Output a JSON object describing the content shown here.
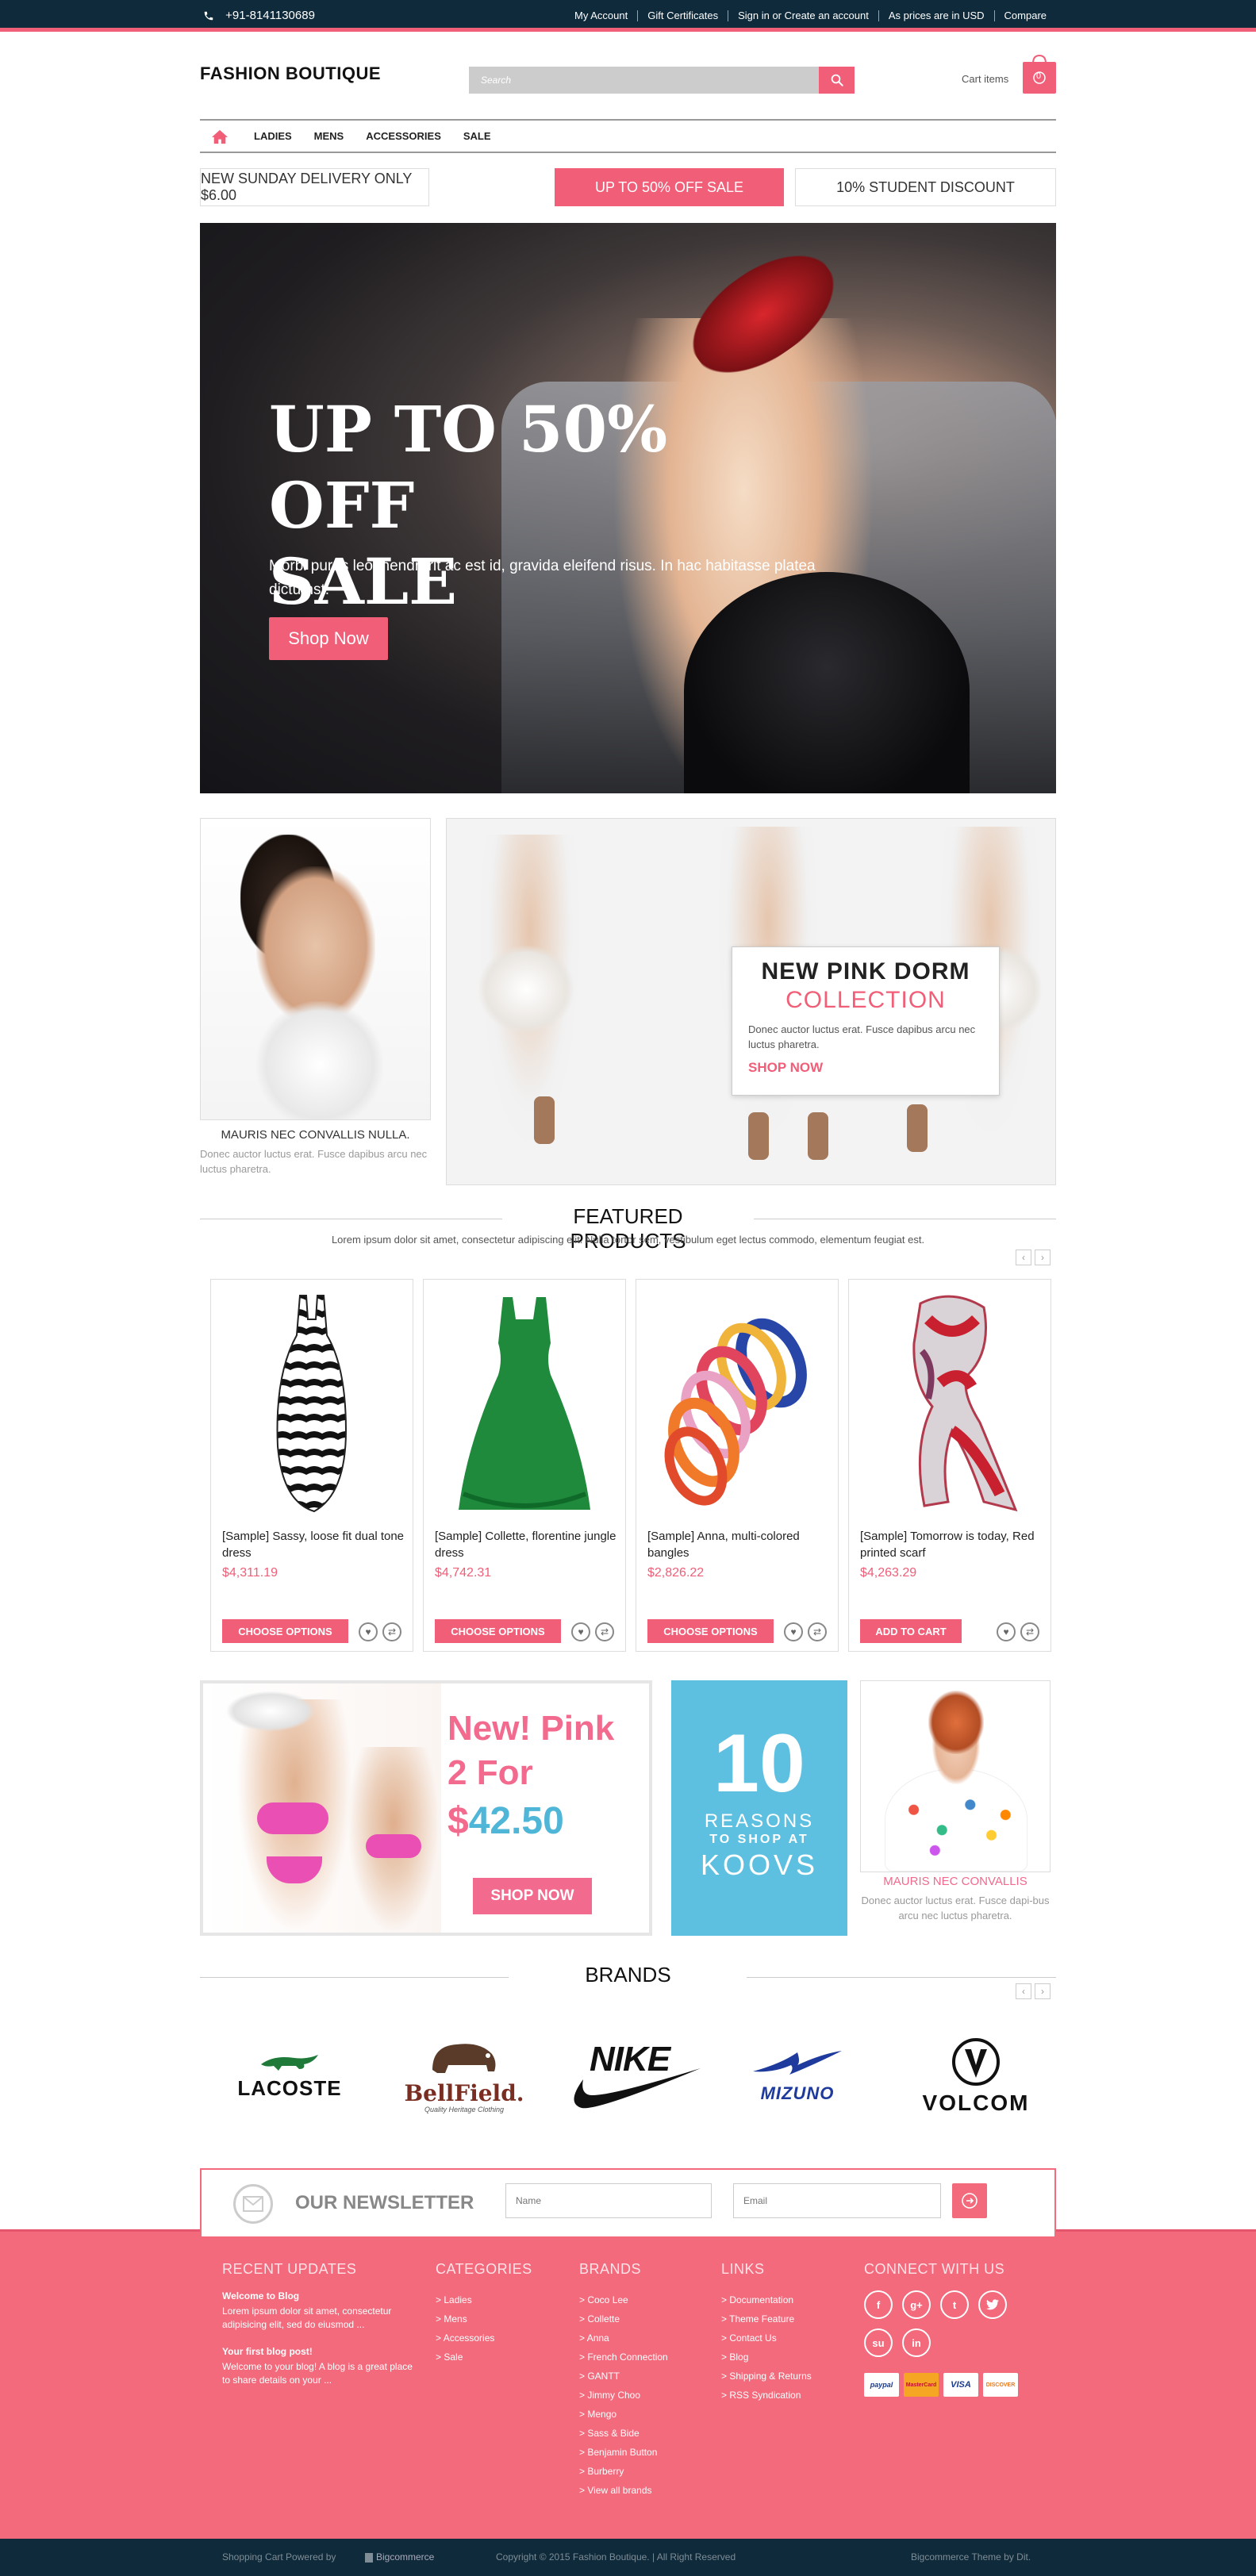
{
  "topbar": {
    "phone": "+91-8141130689",
    "links": [
      "My Account",
      "Gift Certificates",
      "Sign in or Create an account",
      "As prices are in USD",
      "Compare"
    ]
  },
  "header": {
    "logo": "FASHION BOUTIQUE",
    "search_placeholder": "Search",
    "cart_label": "Cart items",
    "cart_count": "0"
  },
  "nav": {
    "items": [
      "LADIES",
      "MENS",
      "ACCESSORIES",
      "SALE"
    ]
  },
  "promos": [
    "NEW SUNDAY DELIVERY ONLY $6.00",
    "UP TO 50% OFF SALE",
    "10% STUDENT DISCOUNT"
  ],
  "hero": {
    "title_line1": "UP TO 50% OFF",
    "title_line2": "SALE",
    "text": "Morbi purus leo, hendrerit ac est id, gravida eleifend risus. In hac habitasse platea dictumst.",
    "button": "Shop Now"
  },
  "banner_left": {
    "caption": "MAURIS NEC CONVALLIS NULLA.",
    "text": "Donec auctor luctus erat. Fusce dapibus arcu nec luctus pharetra."
  },
  "banner_right": {
    "title1": "NEW PINK DORM",
    "title2": "COLLECTION",
    "text": "Donec auctor luctus erat. Fusce dapibus arcu nec luctus pharetra.",
    "link": "SHOP NOW"
  },
  "featured": {
    "title": "FEATURED PRODUCTS",
    "subtitle": "Lorem ipsum dolor sit amet, consectetur adipiscing elit. Nulla tortor sem, vestibulum eget lectus commodo, elementum feugiat est.",
    "products": [
      {
        "name": "[Sample] Sassy, loose fit dual tone dress",
        "price": "$4,311.19",
        "button": "CHOOSE OPTIONS"
      },
      {
        "name": "[Sample] Collette, florentine jungle dress",
        "price": "$4,742.31",
        "button": "CHOOSE OPTIONS"
      },
      {
        "name": "[Sample] Anna, multi-colored bangles",
        "price": "$2,826.22",
        "button": "CHOOSE OPTIONS"
      },
      {
        "name": "[Sample] Tomorrow is today, Red printed scarf",
        "price": "$4,263.29",
        "button": "ADD TO CART"
      }
    ]
  },
  "promo_pink": {
    "line1": "New! Pink",
    "line2": "2 For",
    "currency": "$",
    "amount": "42.50",
    "button": "SHOP NOW"
  },
  "promo_blue": {
    "number": "10",
    "line1": "REASONS",
    "line2": "TO SHOP AT",
    "line3": "KOOVS"
  },
  "promo_girl": {
    "caption": "MAURIS NEC CONVALLIS",
    "text": "Donec auctor luctus erat. Fusce dapi-bus arcu nec luctus pharetra."
  },
  "brands": {
    "title": "BRANDS",
    "logos": [
      "LACOSTE",
      "BellField.",
      "Quality Heritage Clothing",
      "NIKE",
      "MIZUNO",
      "VOLCOM"
    ]
  },
  "newsletter": {
    "title": "OUR NEWSLETTER",
    "name_placeholder": "Name",
    "email_placeholder": "Email"
  },
  "footer": {
    "recent": {
      "heading": "RECENT UPDATES",
      "posts": [
        {
          "title": "Welcome to Blog",
          "text": "Lorem ipsum dolor sit amet, consectetur adipisicing elit, sed do eiusmod ..."
        },
        {
          "title": "Your first blog post!",
          "text": "Welcome to your blog! A blog is a great place to share details on your ..."
        }
      ]
    },
    "categories": {
      "heading": "CATEGORIES",
      "items": [
        "Ladies",
        "Mens",
        "Accessories",
        "Sale"
      ]
    },
    "brands": {
      "heading": "BRANDS",
      "items": [
        "Coco Lee",
        "Collette",
        "Anna",
        "French Connection",
        "GANTT",
        "Jimmy Choo",
        "Mengo",
        "Sass & Bide",
        "Benjamin Button",
        "Burberry",
        "View all brands"
      ]
    },
    "links": {
      "heading": "LINKS",
      "items": [
        "Documentation",
        "Theme Feature",
        "Contact Us",
        "Blog",
        "Shipping & Returns",
        "RSS Syndication"
      ]
    },
    "connect": {
      "heading": "CONNECT WITH US",
      "cards": [
        "paypal",
        "MasterCard",
        "VISA",
        "DISCOVER"
      ]
    },
    "bottom_left": "Shopping Cart Powered by",
    "bottom_left_brand": "Bigcommerce",
    "bottom_center": "Copyright © 2015 Fashion Boutique. | All Right Reserved",
    "bottom_right": "Bigcommerce Theme by Dit."
  },
  "colors": {
    "accent": "#f05e78",
    "dark": "#0f2a3a",
    "blue": "#5ec0e0"
  }
}
